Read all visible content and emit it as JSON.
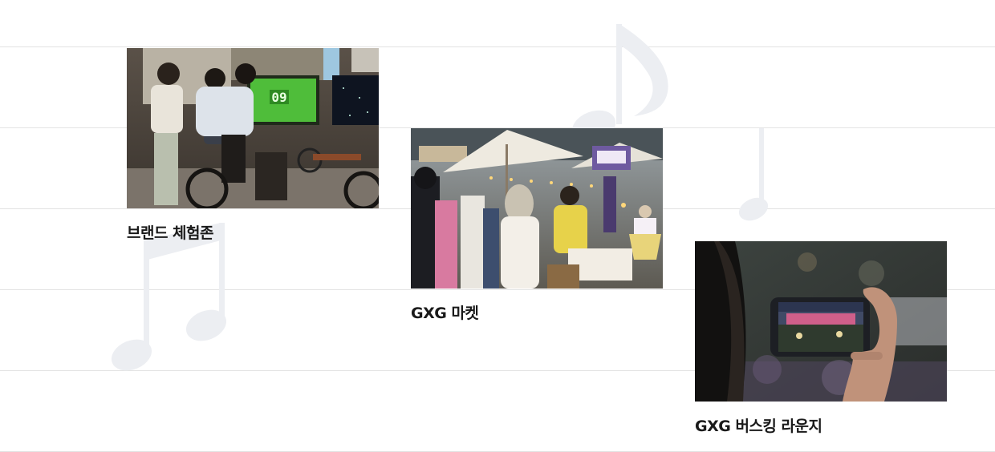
{
  "cards": [
    {
      "caption": "브랜드 체험존",
      "image": "people riding exercise bikes in front of a green screen display"
    },
    {
      "caption": "GXG 마켓",
      "image": "crowd at outdoor market stalls with white umbrellas"
    },
    {
      "caption": "GXG 버스킹 라운지",
      "image": "hand holding a smartphone recording a stage performance"
    }
  ],
  "screen_text": "09",
  "colors": {
    "background": "#ffffff",
    "staff_lines": "#e3e3e3",
    "note_decoration": "#eceef2",
    "caption_text": "#1a1a1a"
  },
  "decorations": [
    "music-note-icon",
    "music-note-icon",
    "eighth-note-icon"
  ]
}
